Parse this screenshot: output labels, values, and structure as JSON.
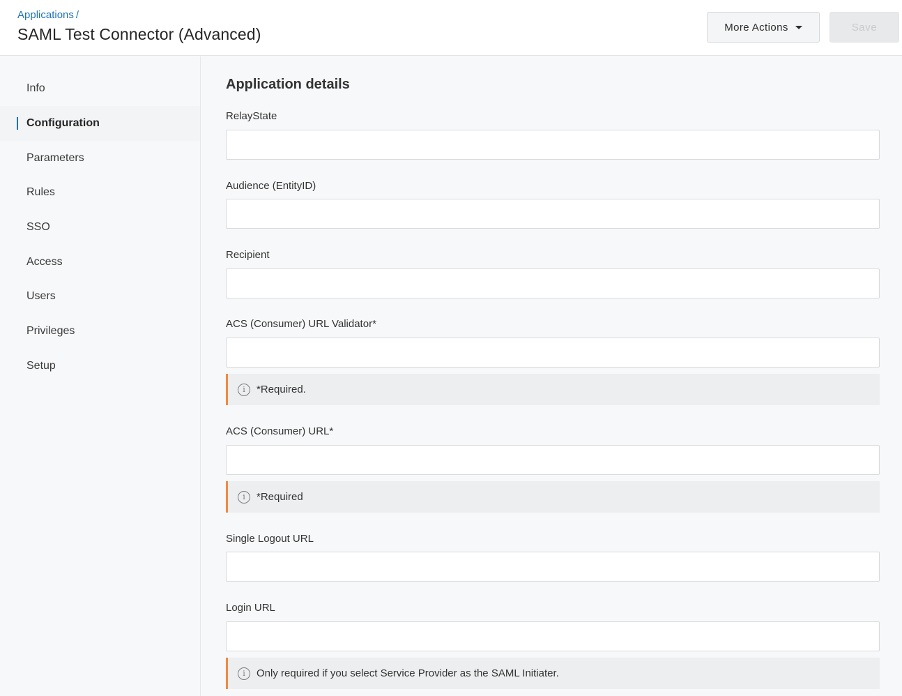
{
  "header": {
    "breadcrumb": "Applications",
    "breadcrumb_sep": "/",
    "title": "SAML Test Connector (Advanced)",
    "more_actions_label": "More Actions",
    "save_label": "Save"
  },
  "sidebar": {
    "items": [
      {
        "label": "Info"
      },
      {
        "label": "Configuration",
        "active": true
      },
      {
        "label": "Parameters"
      },
      {
        "label": "Rules"
      },
      {
        "label": "SSO"
      },
      {
        "label": "Access"
      },
      {
        "label": "Users"
      },
      {
        "label": "Privileges"
      },
      {
        "label": "Setup"
      }
    ]
  },
  "main": {
    "section_title": "Application details",
    "fields": [
      {
        "label": "RelayState",
        "value": ""
      },
      {
        "label": "Audience (EntityID)",
        "value": ""
      },
      {
        "label": "Recipient",
        "value": ""
      },
      {
        "label": "ACS (Consumer) URL Validator*",
        "value": ""
      },
      {
        "label": "ACS (Consumer) URL*",
        "value": ""
      },
      {
        "label": "Single Logout URL",
        "value": ""
      },
      {
        "label": "Login URL",
        "value": ""
      }
    ],
    "notices": [
      {
        "text": "*Required."
      },
      {
        "text": "*Required"
      },
      {
        "text": "Only required if you select Service Provider as the SAML Initiater."
      }
    ],
    "info_icon_glyph": "i"
  },
  "colors": {
    "link": "#1f73b7",
    "notice_accent": "#f08a3e",
    "active_indicator": "#1f73b7"
  },
  "icons": [
    "chevron-down-icon",
    "info-icon"
  ]
}
